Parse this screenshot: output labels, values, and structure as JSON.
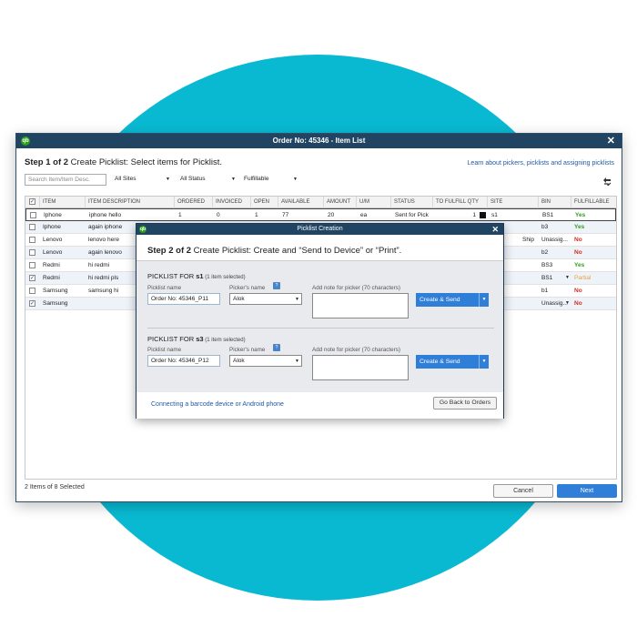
{
  "main_window": {
    "title": "Order No: 45346 - Item List",
    "logo": "qb",
    "close_glyph": "✕",
    "step_bold": "Step 1 of 2",
    "step_text": " Create Picklist: Select items for Picklist.",
    "learn_link": "Learn about pickers, picklists and assigning picklists",
    "refresh_icon": "refresh-icon",
    "filters": {
      "search_placeholder": "Search Item/Item Desc.",
      "sites": "All Sites",
      "status": "All Status",
      "fulfillable": "Fulfillable"
    },
    "columns": [
      "ITEM",
      "ITEM DESCRIPTION",
      "ORDERED",
      "INVOICED",
      "OPEN",
      "AVAILABLE",
      "AMOUNT",
      "U/M",
      "STATUS",
      "TO FULFILL QTY",
      "SITE",
      "BIN",
      "FULFILLABLE"
    ],
    "rows": [
      {
        "checked": false,
        "item": "Iphone",
        "desc": "iphone hello",
        "ordered": "1",
        "invoiced": "0",
        "open": "1",
        "available": "77",
        "amount": "20",
        "um": "ea",
        "status": "Sent for Pick",
        "qty": "1",
        "site": "s1",
        "bin": "BS1",
        "fulfillable": "Yes"
      },
      {
        "checked": false,
        "item": "Iphone",
        "desc": "again iphone",
        "bin": "b3",
        "fulfillable": "Yes"
      },
      {
        "checked": false,
        "item": "Lenovo",
        "desc": "lenovo here",
        "site_partial": "Ship",
        "bin": "Unassig...",
        "fulfillable": "No"
      },
      {
        "checked": false,
        "item": "Lenovo",
        "desc": "again lenovo",
        "bin": "b2",
        "fulfillable": "No"
      },
      {
        "checked": false,
        "item": "Redmi",
        "desc": "hi redmi",
        "bin": "BS3",
        "fulfillable": "Yes"
      },
      {
        "checked": true,
        "item": "Redmi",
        "desc": "hi redmi pls",
        "bin": "BS1",
        "fulfillable": "Partial"
      },
      {
        "checked": false,
        "item": "Samsung",
        "desc": "samsung hi",
        "bin": "b1",
        "fulfillable": "No"
      },
      {
        "checked": true,
        "item": "Samsung",
        "desc": "",
        "bin": "Unassig...",
        "fulfillable": "No"
      }
    ],
    "footer_count": "2 Items of 8 Selected",
    "cancel_label": "Cancel",
    "next_label": "Next"
  },
  "modal": {
    "title": "Picklist Creation",
    "step_bold": "Step 2 of 2",
    "step_text": " Create Picklist: Create and “Send to Device” or “Print”.",
    "picklists": [
      {
        "heading_prefix": "PICKLIST FOR ",
        "site": "s1",
        "count": " (1 item selected)",
        "name_label": "Picklist name",
        "name_value": "Order No: 45346_P11",
        "picker_label": "Picker's name",
        "picker_value": "Alok",
        "note_label": "Add note for picker (70 characters)",
        "button_label": "Create & Send"
      },
      {
        "heading_prefix": "PICKLIST FOR ",
        "site": "s3",
        "count": " (1 item selected)",
        "name_label": "Picklist name",
        "name_value": "Order No: 45346_P12",
        "picker_label": "Picker's name",
        "picker_value": "Alok",
        "note_label": "Add note for picker (70 characters)",
        "button_label": "Create & Send"
      }
    ],
    "connect_link": "Connecting a barcode device or Android phone",
    "back_label": "Go Back to Orders"
  },
  "colors": {
    "teal": "#09b9d2",
    "titlebar": "#214462",
    "primary": "#2f7fd8",
    "yes": "#2ca01c",
    "no": "#d52b1e",
    "partial": "#e8a33c"
  }
}
